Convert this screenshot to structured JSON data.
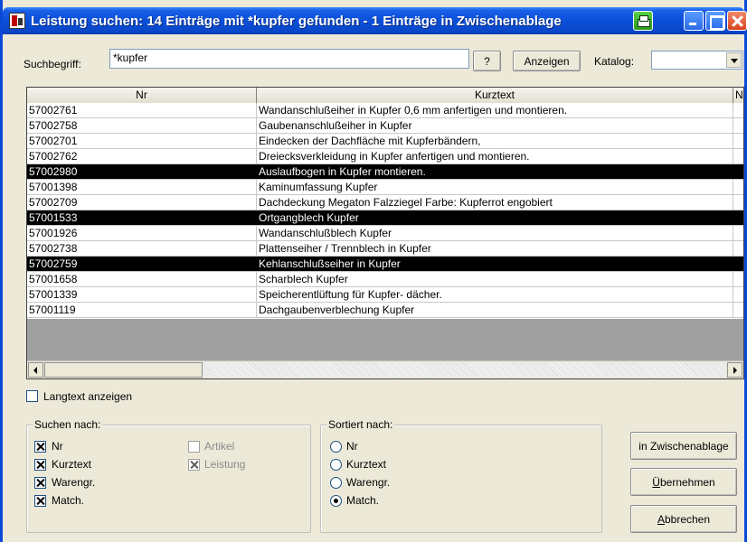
{
  "window": {
    "title": "Leistung suchen: 14 Einträge mit *kupfer gefunden - 1 Einträge in Zwischenablage"
  },
  "search": {
    "label": "Suchbegriff:",
    "value": "*kupfer",
    "help_label": "?",
    "show_label": "Anzeigen",
    "catalog_label": "Katalog:",
    "catalog_value": ""
  },
  "table": {
    "columns": [
      "Nr",
      "Kurztext",
      "Ne"
    ],
    "rows": [
      {
        "nr": "57002761",
        "kurztext": "Wandanschlußeiher in Kupfer  0,6 mm  anfertigen und montieren.",
        "selected": false
      },
      {
        "nr": "57002758",
        "kurztext": "Gaubenanschlußeiher in Kupfer",
        "selected": false
      },
      {
        "nr": "57002701",
        "kurztext": "Eindecken der Dachfläche mit Kupferbändern,",
        "selected": false
      },
      {
        "nr": "57002762",
        "kurztext": "Dreiecksverkleidung in Kupfer  anfertigen und montieren.",
        "selected": false
      },
      {
        "nr": "57002980",
        "kurztext": "Auslaufbogen in Kupfer montieren.",
        "selected": true
      },
      {
        "nr": "57001398",
        "kurztext": "Kaminumfassung Kupfer",
        "selected": false
      },
      {
        "nr": "57002709",
        "kurztext": "Dachdeckung Megaton Falzziegel Farbe: Kupferrot engobiert",
        "selected": false
      },
      {
        "nr": "57001533",
        "kurztext": "Ortgangblech Kupfer",
        "selected": true
      },
      {
        "nr": "57001926",
        "kurztext": "Wandanschlußblech Kupfer",
        "selected": false
      },
      {
        "nr": "57002738",
        "kurztext": "Plattenseiher / Trennblech in Kupfer",
        "selected": false
      },
      {
        "nr": "57002759",
        "kurztext": "Kehlanschlußseiher in Kupfer",
        "selected": true
      },
      {
        "nr": "57001658",
        "kurztext": "Scharblech Kupfer",
        "selected": false
      },
      {
        "nr": "57001339",
        "kurztext": "Speicherentlüftung für Kupfer- dächer.",
        "selected": false
      },
      {
        "nr": "57001119",
        "kurztext": "Dachgaubenverblechung Kupfer",
        "selected": false
      }
    ]
  },
  "langtext": {
    "label": "Langtext anzeigen",
    "checked": false
  },
  "suchen_nach": {
    "title": "Suchen nach:",
    "options": [
      {
        "label": "Nr",
        "checked": true,
        "enabled": true
      },
      {
        "label": "Kurztext",
        "checked": true,
        "enabled": true
      },
      {
        "label": "Warengr.",
        "checked": true,
        "enabled": true
      },
      {
        "label": "Match.",
        "checked": true,
        "enabled": true
      },
      {
        "label": "Artikel",
        "checked": false,
        "enabled": false
      },
      {
        "label": "Leistung",
        "checked": true,
        "enabled": false
      }
    ]
  },
  "sortiert_nach": {
    "title": "Sortiert nach:",
    "options": [
      "Nr",
      "Kurztext",
      "Warengr.",
      "Match."
    ],
    "selected": "Match."
  },
  "actions": {
    "zwischenablage": "in Zwischenablage",
    "uebernehmen_first": "Ü",
    "uebernehmen_rest": "bernehmen",
    "abbrechen_first": "A",
    "abbrechen_rest": "bbrechen"
  },
  "icons": {
    "app": "app-document-icon",
    "print": "print-icon",
    "minimize": "minimize-icon",
    "maximize": "maximize-icon",
    "close": "close-icon"
  }
}
